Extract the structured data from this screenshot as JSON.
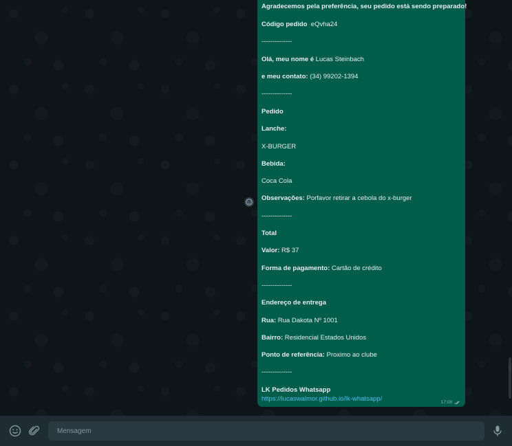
{
  "message": {
    "greeting": "Agradecemos pela preferência, seu pedido está sendo preparado!",
    "order_code_label": "Código pedido",
    "order_code_value": "eQvha24",
    "separator": "--------------",
    "name_label": "Olá, meu nome é",
    "name_value": "Lucas Steinbach",
    "contact_label": "e meu contato:",
    "contact_value": "(34) 99202-1394",
    "order_heading": "Pedido",
    "snack_label": "Lanche:",
    "snack_value": "X-BURGER",
    "drink_label": "Bebida:",
    "drink_value": "Coca Cola",
    "notes_label": "Observações:",
    "notes_value": "Porfavor retirar a cebola do x-burger",
    "total_heading": "Total",
    "value_label": "Valor:",
    "value_value": "R$ 37",
    "payment_label": "Forma de pagamento:",
    "payment_value": "Cartão de crédito",
    "address_heading": "Endereço de entrega",
    "street_label": "Rua:",
    "street_value": "Rua Dakota Nº 1001",
    "district_label": "Bairro:",
    "district_value": "Residencial Estados Unidos",
    "reference_label": "Ponto de referência:",
    "reference_value": "Proximo ao clube",
    "signature": "LK Pedidos Whatsapp",
    "link": "https://lucaswalmor.github.io/lk-whatsapp/",
    "time": "17:08"
  },
  "footer": {
    "placeholder": "Mensagem",
    "emoji_icon": "emoji-icon",
    "attach_icon": "paperclip-icon",
    "mic_icon": "microphone-icon"
  },
  "colors": {
    "bubble": "#005c4b",
    "link": "#53bdeb",
    "footer": "#1f2c33"
  }
}
